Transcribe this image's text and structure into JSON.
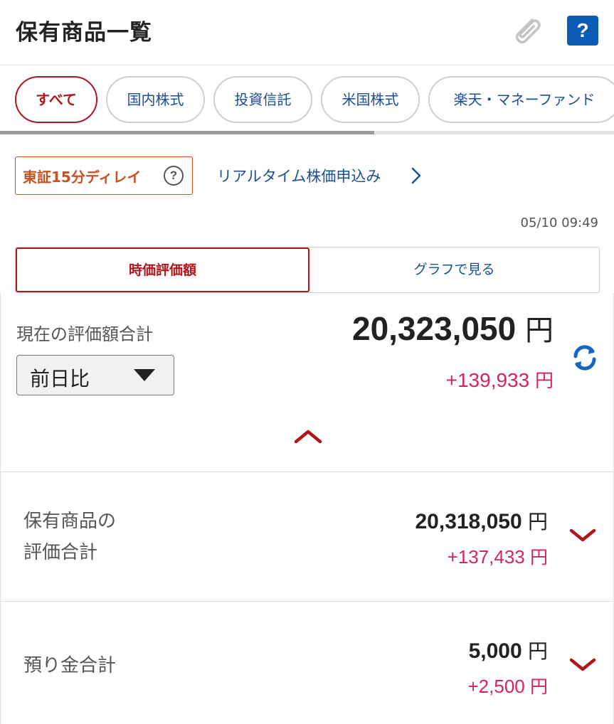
{
  "header": {
    "title": "保有商品一覧",
    "clip_icon": "paperclip-icon",
    "help_label": "?"
  },
  "tabs": [
    {
      "label": "すべて",
      "active": true
    },
    {
      "label": "国内株式",
      "active": false
    },
    {
      "label": "投資信託",
      "active": false
    },
    {
      "label": "米国株式",
      "active": false
    },
    {
      "label": "楽天・マネーファンド",
      "active": false
    }
  ],
  "notice": {
    "delay_label": "東証15分ディレイ",
    "delay_help": "?",
    "realtime_link": "リアルタイム株価申込み"
  },
  "timestamp": "05/10 09:49",
  "view_toggle": {
    "market_value": "時価評価額",
    "graph": "グラフで見る"
  },
  "summary": {
    "label": "現在の評価額合計",
    "value": "20,323,050",
    "unit": "円",
    "change": "+139,933",
    "change_unit": "円",
    "period_select": "前日比"
  },
  "rows": [
    {
      "label_line1": "保有商品の",
      "label_line2": "評価合計",
      "value": "20,318,050",
      "unit": "円",
      "change": "+137,433",
      "change_unit": "円"
    },
    {
      "label_line1": "預り金合計",
      "label_line2": "",
      "value": "5,000",
      "unit": "円",
      "change": "+2,500",
      "change_unit": "円"
    }
  ],
  "colors": {
    "accent_red": "#b0161c",
    "link_blue": "#1b4f93",
    "positive_change": "#d6245a",
    "delay_orange": "#c9501f",
    "help_blue": "#0d5bb5"
  },
  "scroll": {
    "tabs_visible_fraction": 0.61
  }
}
